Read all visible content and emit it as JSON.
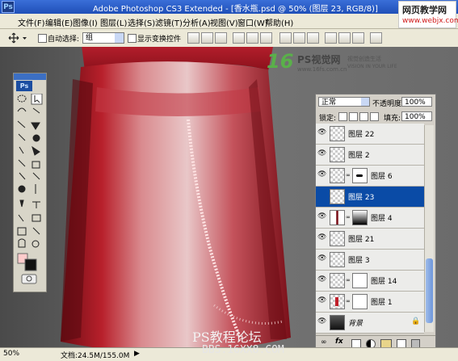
{
  "app": {
    "title": "Adobe Photoshop CS3 Extended - [香水瓶.psd @ 50% (图层 23, RGB/8)]",
    "ps_badge": "Ps"
  },
  "menu": [
    "文件(F)",
    "编辑(E)",
    "图像(I)",
    "图层(L)",
    "选择(S)",
    "滤镜(T)",
    "分析(A)",
    "视图(V)",
    "窗口(W)",
    "帮助(H)"
  ],
  "watermark": {
    "line1": "网页教学网",
    "line2": "www.webjx.com"
  },
  "options": {
    "auto_select_label": "自动选择:",
    "auto_select_value": "组",
    "show_transform_label": "显示变换控件"
  },
  "logo": {
    "brand": "16",
    "name": "PS视觉网",
    "url": "www.16fs.com.cn",
    "slogan1": "视觉创造生活",
    "slogan2": "VISION IN YOUR LIFE"
  },
  "toolbox": {
    "logo": "Ps"
  },
  "layers": {
    "blend_mode": "正常",
    "opacity_label": "不透明度:",
    "opacity_value": "100%",
    "lock_label": "锁定:",
    "fill_label": "填充:",
    "fill_value": "100%",
    "items": [
      {
        "name": "图层 22"
      },
      {
        "name": "图层 2"
      },
      {
        "name": "图层 6"
      },
      {
        "name": "图层 23"
      },
      {
        "name": "图层 4"
      },
      {
        "name": "图层 21"
      },
      {
        "name": "图层 3"
      },
      {
        "name": "图层 14"
      },
      {
        "name": "图层 1"
      },
      {
        "name": "背景"
      }
    ],
    "selected_index": 3
  },
  "status": {
    "zoom": "50%",
    "doc": "文档:24.5M/155.0M"
  },
  "overlay": {
    "forum": "PS教程论坛",
    "forum_url": "BBS.16XX8.COM"
  },
  "colors": {
    "accent": "#0a4ba6",
    "titlebar": "#2a5ed0",
    "bottle": "#b8202b"
  }
}
